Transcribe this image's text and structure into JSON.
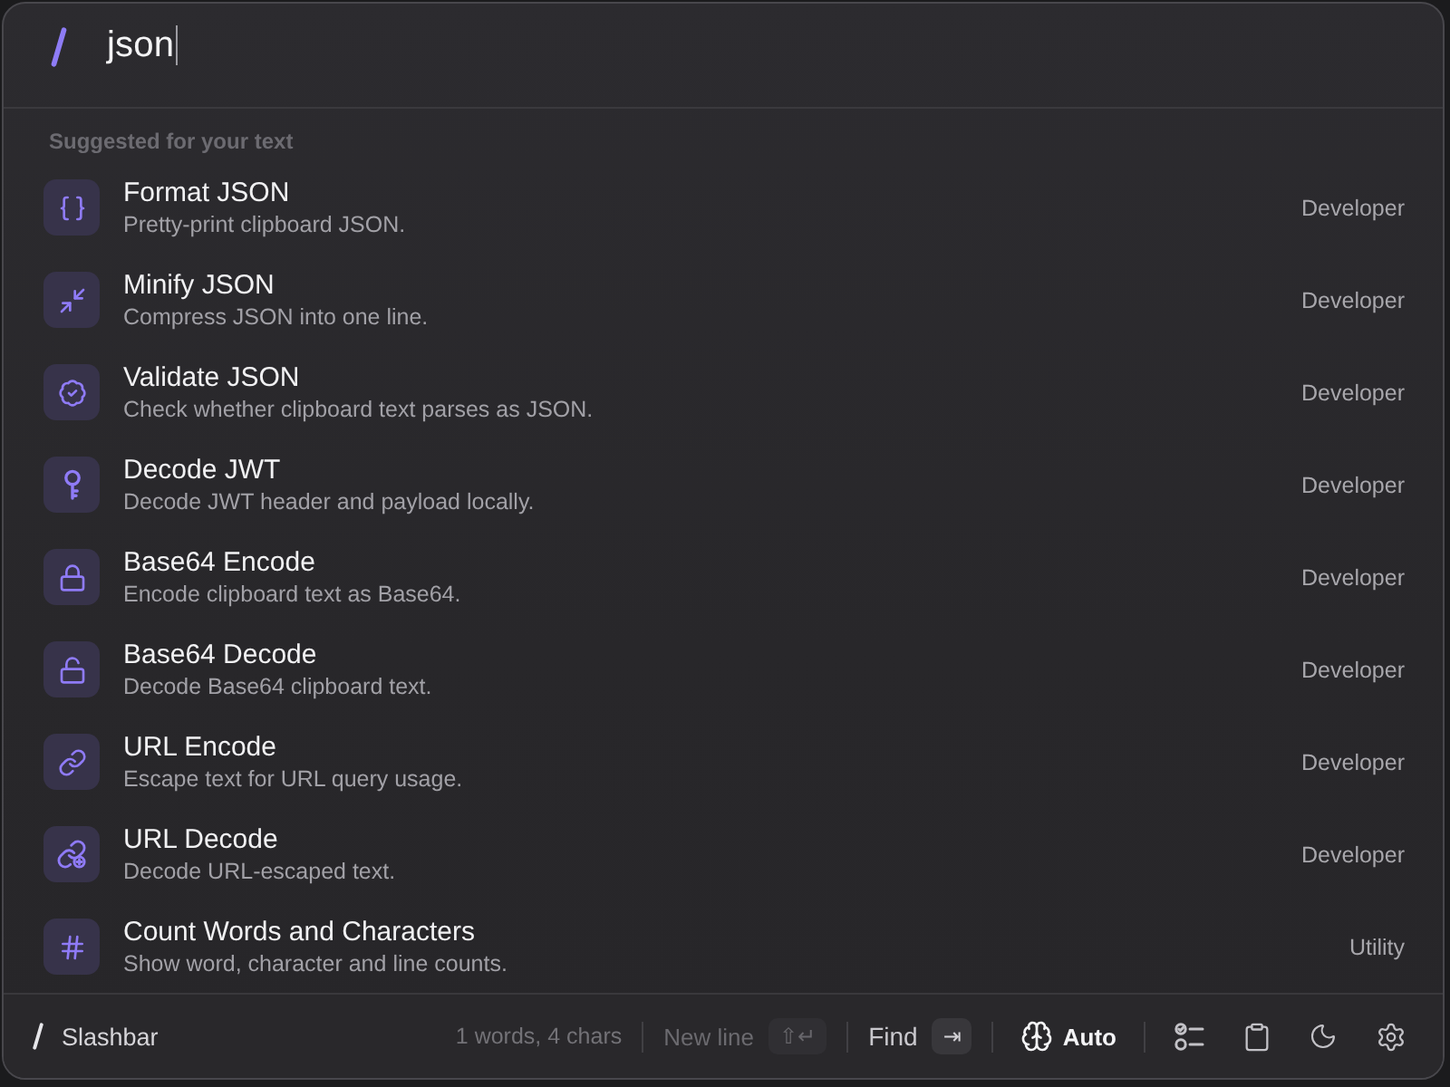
{
  "search": {
    "value": "json"
  },
  "section": {
    "title": "Suggested for your text"
  },
  "commands": [
    {
      "title": "Format JSON",
      "description": "Pretty-print clipboard JSON.",
      "category": "Developer"
    },
    {
      "title": "Minify JSON",
      "description": "Compress JSON into one line.",
      "category": "Developer"
    },
    {
      "title": "Validate JSON",
      "description": "Check whether clipboard text parses as JSON.",
      "category": "Developer"
    },
    {
      "title": "Decode JWT",
      "description": "Decode JWT header and payload locally.",
      "category": "Developer"
    },
    {
      "title": "Base64 Encode",
      "description": "Encode clipboard text as Base64.",
      "category": "Developer"
    },
    {
      "title": "Base64 Decode",
      "description": "Decode Base64 clipboard text.",
      "category": "Developer"
    },
    {
      "title": "URL Encode",
      "description": "Escape text for URL query usage.",
      "category": "Developer"
    },
    {
      "title": "URL Decode",
      "description": "Decode URL-escaped text.",
      "category": "Developer"
    },
    {
      "title": "Count Words and Characters",
      "description": "Show word, character and line counts.",
      "category": "Utility"
    }
  ],
  "footer": {
    "app_name": "Slashbar",
    "stats": "1 words, 4 chars",
    "actions": [
      {
        "label": "New line",
        "keys": "⇧↵",
        "disabled": true
      },
      {
        "label": "Find",
        "keys": "⇥",
        "disabled": false
      }
    ],
    "mode": {
      "label": "Auto"
    }
  }
}
